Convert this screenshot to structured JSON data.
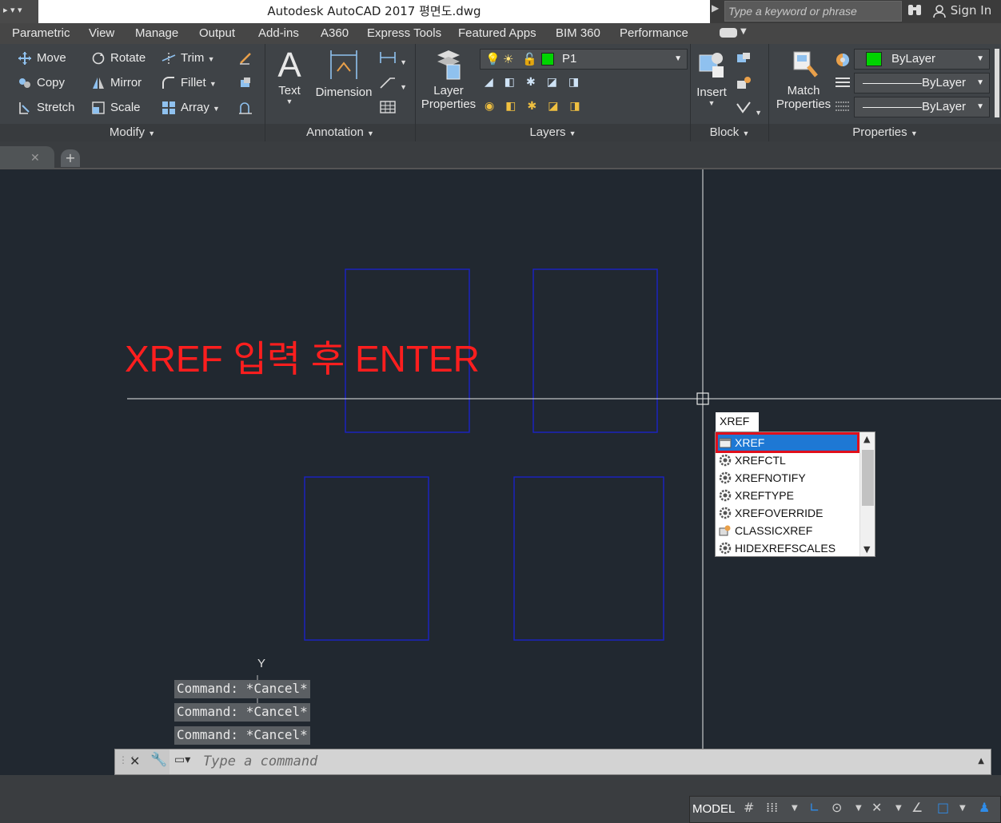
{
  "titlebar": {
    "title": "Autodesk AutoCAD 2017     평면도.dwg",
    "search_placeholder": "Type a keyword or phrase",
    "signin": "Sign In"
  },
  "menubar": {
    "items": [
      "Parametric",
      "View",
      "Manage",
      "Output",
      "Add-ins",
      "A360",
      "Express Tools",
      "Featured Apps",
      "BIM 360",
      "Performance"
    ]
  },
  "ribbon": {
    "modify": {
      "title": "Modify",
      "buttons": [
        "Move",
        "Rotate",
        "Trim",
        "Copy",
        "Mirror",
        "Fillet",
        "Stretch",
        "Scale",
        "Array"
      ]
    },
    "annotation": {
      "title": "Annotation",
      "text": "Text",
      "dimension": "Dimension"
    },
    "layers": {
      "title": "Layers",
      "layer_properties_1": "Layer",
      "layer_properties_2": "Properties",
      "current_layer": "P1"
    },
    "block": {
      "title": "Block",
      "insert": "Insert"
    },
    "properties": {
      "title": "Properties",
      "match_1": "Match",
      "match_2": "Properties",
      "color": "ByLayer",
      "linetype": "ByLayer",
      "lineweight": "ByLayer"
    }
  },
  "annotation_text": "XREF 입력 후 ENTER",
  "autocomplete": {
    "typed": "XREF",
    "items": [
      "XREF",
      "XREFCTL",
      "XREFNOTIFY",
      "XREFTYPE",
      "XREFOVERRIDE",
      "CLASSICXREF",
      "HIDEXREFSCALES"
    ],
    "selected_index": 0
  },
  "ucs": {
    "y_label": "Y"
  },
  "command_history": [
    "Command: *Cancel*",
    "Command: *Cancel*",
    "Command: *Cancel*"
  ],
  "command_line": {
    "placeholder": "Type a command"
  },
  "statusbar": {
    "model": "MODEL"
  },
  "colors": {
    "accent": "#1e78d4",
    "highlight_box": "#e0101c",
    "annotation": "#ff1e1e",
    "rect_stroke": "#1a22c8",
    "canvas_bg": "#212830"
  }
}
